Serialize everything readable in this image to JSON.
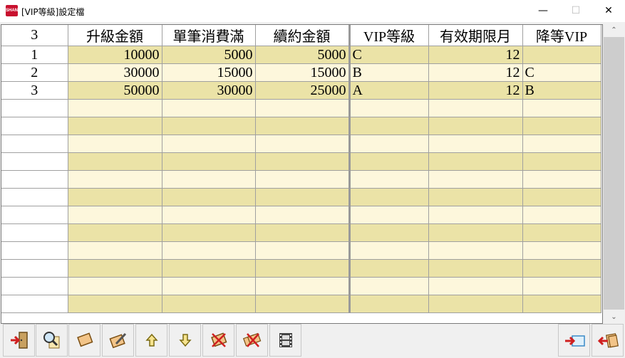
{
  "window": {
    "title": "[VIP等級]設定檔",
    "minimize_glyph": "—",
    "maximize_glyph": "☐",
    "close_glyph": "✕",
    "app_icon_text": "SHAN"
  },
  "grid": {
    "row_count_label": "3",
    "columns": [
      "升級金額",
      "單筆消費滿",
      "續約金額",
      "VIP等級",
      "有效期限月",
      "降等VIP"
    ],
    "rows": [
      {
        "index": "1",
        "cells": [
          "10000",
          "5000",
          "5000",
          "C",
          "12",
          ""
        ]
      },
      {
        "index": "2",
        "cells": [
          "30000",
          "15000",
          "15000",
          "B",
          "12",
          "C"
        ]
      },
      {
        "index": "3",
        "cells": [
          "50000",
          "30000",
          "25000",
          "A",
          "12",
          "B"
        ]
      }
    ],
    "empty_rows": 12
  },
  "scrollbar": {
    "up_glyph": "⌃",
    "down_glyph": "⌄"
  },
  "toolbar": {
    "buttons": [
      {
        "name": "exit-button",
        "icon": "exit-door-icon"
      },
      {
        "name": "search-button",
        "icon": "magnifier-icon"
      },
      {
        "name": "add-button",
        "icon": "card-icon"
      },
      {
        "name": "edit-button",
        "icon": "pencil-card-icon"
      },
      {
        "name": "move-up-button",
        "icon": "arrow-up-icon"
      },
      {
        "name": "move-down-button",
        "icon": "arrow-down-icon"
      },
      {
        "name": "delete-button",
        "icon": "delete-cross-icon"
      },
      {
        "name": "delete-multi-button",
        "icon": "delete-multi-icon"
      },
      {
        "name": "film-button",
        "icon": "film-icon"
      },
      {
        "name": "export-button",
        "icon": "arrow-right-export-icon"
      },
      {
        "name": "import-button",
        "icon": "arrow-left-import-icon"
      }
    ]
  },
  "colors": {
    "odd_row": "#ebe3a7",
    "even_row": "#fdf7dc",
    "grid_line": "#a0a0a0"
  }
}
